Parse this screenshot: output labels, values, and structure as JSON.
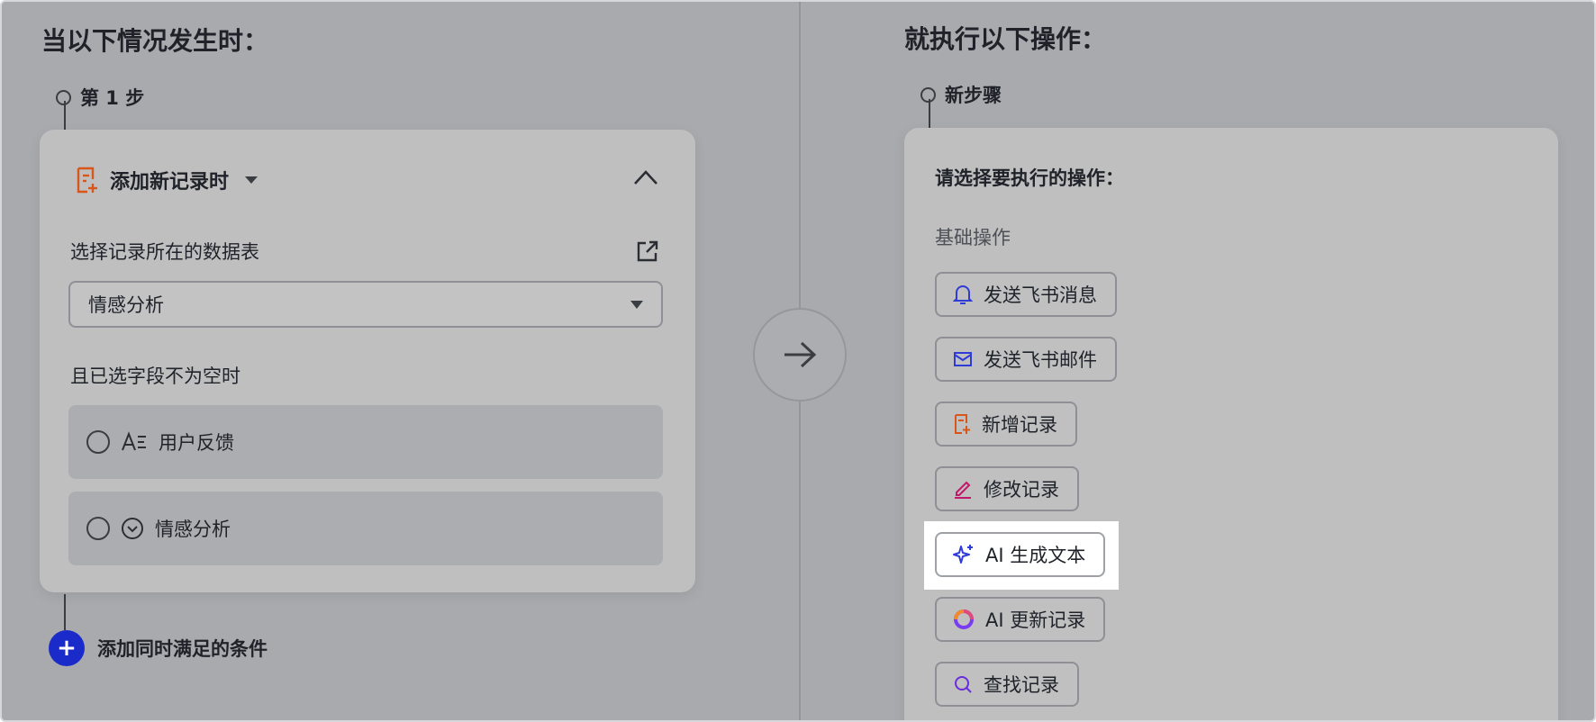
{
  "left": {
    "heading": "当以下情况发生时：",
    "step_label": "第 1 步",
    "trigger": {
      "label": "添加新记录时",
      "table_label": "选择记录所在的数据表",
      "table_value": "情感分析",
      "condition_label": "且已选字段不为空时",
      "fields": [
        {
          "label": "用户反馈",
          "icon": "text-field-icon"
        },
        {
          "label": "情感分析",
          "icon": "single-select-icon"
        }
      ]
    },
    "add_condition": "添加同时满足的条件"
  },
  "right": {
    "heading": "就执行以下操作：",
    "step_label": "新步骤",
    "prompt": "请选择要执行的操作：",
    "section_label": "基础操作",
    "actions": [
      {
        "label": "发送飞书消息",
        "icon": "bell-icon",
        "color": "#2f3bd6"
      },
      {
        "label": "发送飞书邮件",
        "icon": "mail-icon",
        "color": "#2f3bd6"
      },
      {
        "label": "新增记录",
        "icon": "add-record-icon",
        "color": "#d9561a"
      },
      {
        "label": "修改记录",
        "icon": "pencil-icon",
        "color": "#c2186b"
      },
      {
        "label": "AI 生成文本",
        "icon": "sparkle-icon",
        "color": "#2f3bd6"
      },
      {
        "label": "AI 更新记录",
        "icon": "ai-ring-icon",
        "color": "#7a3cf0"
      },
      {
        "label": "查找记录",
        "icon": "search-icon",
        "color": "#6a2ddb"
      }
    ]
  },
  "colors": {
    "overlay": "#a9aaae",
    "card": "#bfbfc0",
    "accent_blue": "#1b2bc9",
    "record_orange": "#d9561a"
  }
}
